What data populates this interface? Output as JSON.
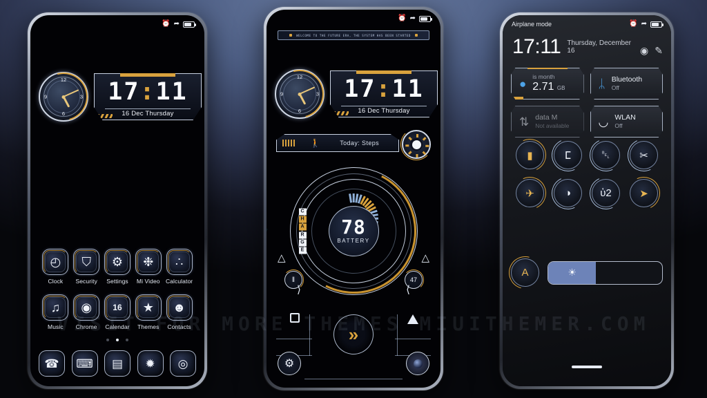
{
  "watermark": "VISIT  FOR  MORE  THEMES    MIUITHEMER.COM",
  "colors": {
    "accent_gold": "#d9a23d",
    "frame_silver": "#cfd7e4",
    "slider_blue": "#6d83b8",
    "bg_top": "#5a6d94"
  },
  "status_bar": {
    "alarm_icon": "alarm-icon",
    "airplane_icon": "airplane-icon",
    "battery_icon": "battery-icon"
  },
  "clock_widget": {
    "time": "17:11",
    "hours": "17",
    "colon": ":",
    "minutes": "11",
    "date": "16 Dec Thursday",
    "analog_numbers": [
      "12",
      "3",
      "6",
      "9"
    ]
  },
  "home_screen": {
    "apps": [
      {
        "label": "Clock",
        "icon": "clock-icon",
        "glyph": "◴"
      },
      {
        "label": "Security",
        "icon": "shield-icon",
        "glyph": "⛉"
      },
      {
        "label": "Settings",
        "icon": "gear-icon",
        "glyph": "⚙"
      },
      {
        "label": "Mi Video",
        "icon": "film-reel-icon",
        "glyph": "❉"
      },
      {
        "label": "Calculator",
        "icon": "calculator-icon",
        "glyph": "∴"
      },
      {
        "label": "Music",
        "icon": "music-note-icon",
        "glyph": "♫"
      },
      {
        "label": "Chrome",
        "icon": "chrome-icon",
        "glyph": "◉"
      },
      {
        "label": "Calendar",
        "icon": "calendar-icon",
        "glyph": "16"
      },
      {
        "label": "Themes",
        "icon": "star-icon",
        "glyph": "★"
      },
      {
        "label": "Contacts",
        "icon": "person-icon",
        "glyph": "☻"
      }
    ],
    "dock": [
      {
        "label": "Phone",
        "icon": "phone-icon",
        "glyph": "☎"
      },
      {
        "label": "Messages",
        "icon": "message-icon",
        "glyph": "⌨"
      },
      {
        "label": "Notes",
        "icon": "notes-icon",
        "glyph": "▤"
      },
      {
        "label": "Gallery",
        "icon": "gallery-icon",
        "glyph": "✹"
      },
      {
        "label": "Camera",
        "icon": "camera-icon",
        "glyph": "◎"
      }
    ],
    "page_dots": 3,
    "active_dot": 2
  },
  "lock_screen": {
    "banner": "WELCOME TO THE FUTURE ERA, THE SYSTEM HAS BEEN STARTED",
    "steps_label": "Today:  Steps",
    "steps_icon": "walking-person-icon",
    "battery": {
      "value": "78",
      "label": "BATTERY",
      "charge_text": "CHARGE"
    },
    "left_button": {
      "name": "pause-button",
      "glyph": "‖"
    },
    "right_button": {
      "name": "counter-button",
      "glyph": "47"
    },
    "nav": {
      "recents": "recents-square-icon",
      "home": "home-chevron-icon",
      "back": "back-triangle-icon",
      "shortcut_left": "gear-shortcut-icon",
      "shortcut_right": "camera-shortcut-icon"
    }
  },
  "notification_shade": {
    "airplane_mode": "Airplane mode",
    "time": "17:11",
    "date": "Thursday, December 16",
    "settings_icon": "gear-icon",
    "edit_icon": "edit-icon",
    "tiles": [
      {
        "name": "data-usage-tile",
        "icon": "water-drop-icon",
        "title": "is month",
        "value": "2.71",
        "unit": "GB",
        "subtitle": "",
        "dim": false,
        "highlight": true
      },
      {
        "name": "bluetooth-tile",
        "icon": "bluetooth-icon",
        "title": "Bluetooth",
        "value": "",
        "unit": "",
        "subtitle": "Off",
        "dim": false,
        "highlight": false
      },
      {
        "name": "mobile-data-tile",
        "icon": "data-arrows-icon",
        "title": "data        M",
        "value": "",
        "unit": "",
        "subtitle": "Not available",
        "dim": true,
        "highlight": false
      },
      {
        "name": "wlan-tile",
        "icon": "wifi-icon",
        "title": "WLAN",
        "value": "",
        "unit": "",
        "subtitle": "Off",
        "dim": false,
        "highlight": false
      }
    ],
    "toggles": [
      {
        "name": "vibrate-toggle",
        "glyph": "▮",
        "active": true
      },
      {
        "name": "flashlight-toggle",
        "glyph": "ⵎ",
        "active": false
      },
      {
        "name": "ring-toggle",
        "glyph": "␇",
        "active": false
      },
      {
        "name": "screenshot-toggle",
        "glyph": "✂",
        "active": false
      },
      {
        "name": "airplane-toggle",
        "glyph": "✈",
        "active": true
      },
      {
        "name": "dark-mode-toggle",
        "glyph": "◑",
        "active": false
      },
      {
        "name": "lock-toggle",
        "glyph": "ὑ2",
        "active": false
      },
      {
        "name": "location-toggle",
        "glyph": "➤",
        "active": true
      }
    ],
    "auto_brightness": {
      "name": "auto-brightness-button",
      "label": "A"
    },
    "brightness": {
      "name": "brightness-slider",
      "percent": 42,
      "icon": "sun-icon"
    }
  }
}
